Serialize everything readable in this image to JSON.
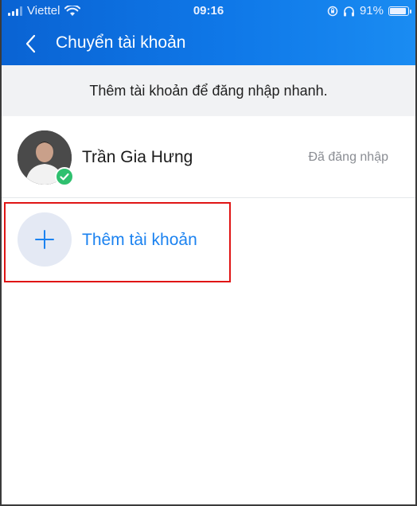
{
  "status_bar": {
    "carrier": "Viettel",
    "time": "09:16",
    "battery_percent": "91%",
    "battery_level": 0.91
  },
  "nav": {
    "title": "Chuyển tài khoản"
  },
  "banner": {
    "text": "Thêm tài khoản để đăng nhập nhanh."
  },
  "account": {
    "name": "Trần Gia Hưng",
    "status": "Đã đăng nhập"
  },
  "add_account": {
    "label": "Thêm tài khoản"
  },
  "colors": {
    "header": "#0f78e8",
    "accent": "#1b82f0",
    "check": "#2fc06f",
    "highlight": "#e01515"
  }
}
